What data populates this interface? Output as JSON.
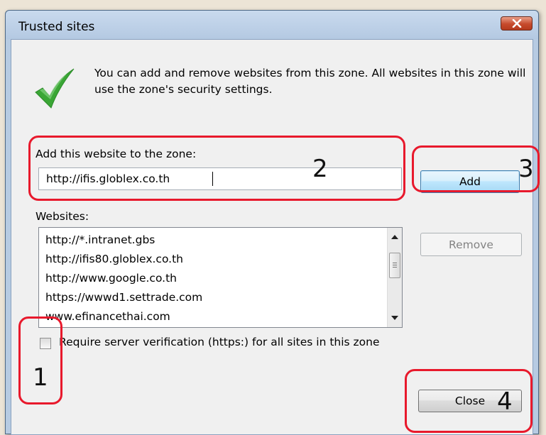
{
  "dialog": {
    "title": "Trusted sites",
    "intro": "You can add and remove websites from this zone. All websites in this zone will use the zone's security settings.",
    "add_label": "Add this website to the zone:",
    "url_value": "http://ifis.globlex.co.th",
    "add_button": "Add",
    "websites_label": "Websites:",
    "websites": [
      "http://*.intranet.gbs",
      "http://ifis80.globlex.co.th",
      "http://www.google.co.th",
      "https://wwwd1.settrade.com",
      "www.efinancethai.com"
    ],
    "remove_button": "Remove",
    "require_https_label": "Require server verification (https:) for all sites in this zone",
    "require_https_checked": false,
    "close_button": "Close"
  },
  "annotations": [
    "1",
    "2",
    "3",
    "4"
  ],
  "colors": {
    "annotation": "#e8192c",
    "checkmark": "#3aa635",
    "title_close": "#c64a2c"
  }
}
